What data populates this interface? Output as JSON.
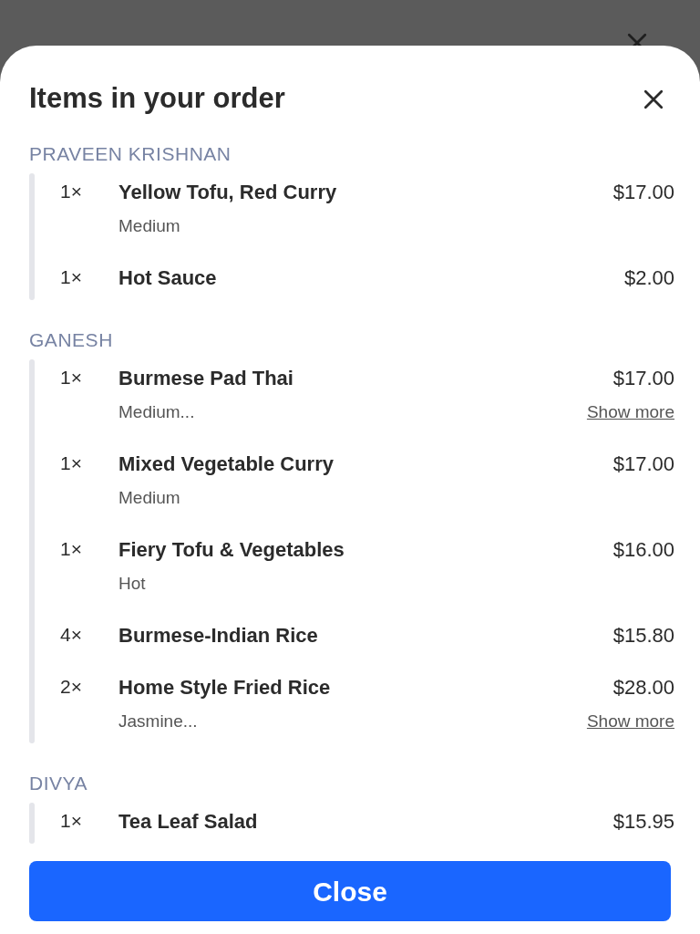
{
  "sheet": {
    "title": "Items in your order"
  },
  "groups": [
    {
      "name": "PRAVEEN KRISHNAN",
      "items": [
        {
          "qty": "1×",
          "name": "Yellow Tofu, Red Curry",
          "price": "$17.00",
          "note": "Medium"
        },
        {
          "qty": "1×",
          "name": "Hot Sauce",
          "price": "$2.00"
        }
      ]
    },
    {
      "name": "GANESH",
      "items": [
        {
          "qty": "1×",
          "name": "Burmese Pad Thai",
          "price": "$17.00",
          "note": "Medium...",
          "more_link": "Show more"
        },
        {
          "qty": "1×",
          "name": "Mixed Vegetable Curry",
          "price": "$17.00",
          "note": "Medium"
        },
        {
          "qty": "1×",
          "name": "Fiery Tofu & Vegetables",
          "price": "$16.00",
          "note": "Hot"
        },
        {
          "qty": "4×",
          "name": "Burmese-Indian Rice",
          "price": "$15.80"
        },
        {
          "qty": "2×",
          "name": "Home Style Fried Rice",
          "price": "$28.00",
          "note": "Jasmine...",
          "more_link": "Show more"
        }
      ]
    },
    {
      "name": "DIVYA",
      "items": [
        {
          "qty": "1×",
          "name": "Tea Leaf Salad",
          "price": "$15.95"
        }
      ]
    }
  ],
  "footer": {
    "button": "Close"
  }
}
